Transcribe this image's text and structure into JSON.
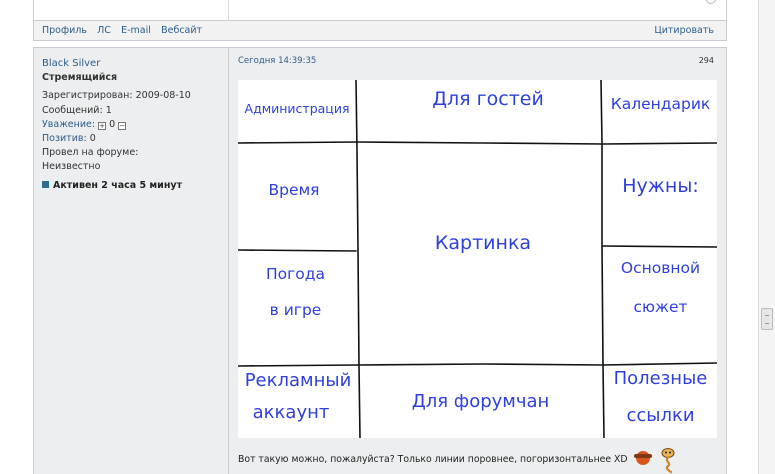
{
  "footer": {
    "links": [
      "Профиль",
      "ЛС",
      "E-mail",
      "Вебсайт"
    ],
    "quote": "Цитировать"
  },
  "author": {
    "name": "Black Silver",
    "rank": "Стремящийся",
    "registered": "Зарегистрирован: 2009-08-10",
    "posts": "Сообщений: 1",
    "respect_label": "Уважение:",
    "respect_value": "0",
    "positive_label": "Позитив:",
    "positive_value": "0",
    "time_on_forum_label": "Провел на форуме:",
    "time_on_forum_value": "Неизвестно",
    "online_status": "Активен 2 часа 5 минут"
  },
  "post": {
    "date": "Сегодня 14:39:35",
    "number": "294",
    "text": "Вот такую можно, пожалуйста? Только линии поровнее, погоризонтальнее XD"
  },
  "picture": {
    "cells": {
      "admin": "Администрация",
      "guests": "Для гостей",
      "calendar": "Календарик",
      "time": "Время",
      "needed": "Нужны:",
      "picture": "Картинка",
      "weather_line1": "Погода",
      "weather_line2": "в игре",
      "plot_line1": "Основной",
      "plot_line2": "сюжет",
      "ad_line1": "Рекламный",
      "ad_line2": "аккаунт",
      "members": "Для форумчан",
      "useful_line1": "Полезные",
      "useful_line2": "ссылки"
    },
    "ink_color": "#2f3fe0"
  },
  "colors": {
    "link": "#2d5d8a",
    "panel": "#eceeef",
    "online_dot": "#2b6e94"
  },
  "icons": {
    "smile": "smile-hat-icon",
    "snake": "snake-smile-icon",
    "plus": "plus-icon",
    "minus": "minus-icon"
  }
}
